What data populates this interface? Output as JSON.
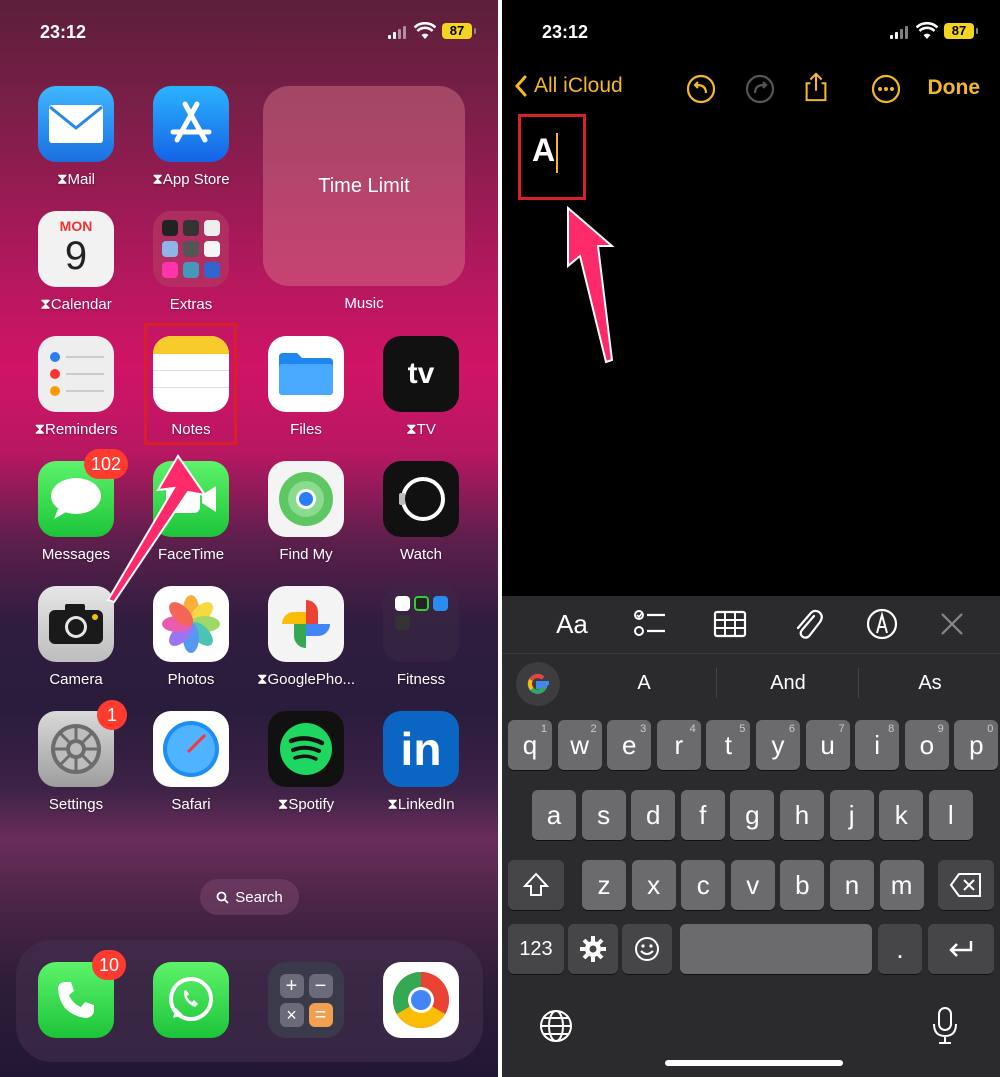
{
  "left_screen": {
    "status": {
      "time": "23:12",
      "battery": "87"
    },
    "apps": {
      "mail": "Mail",
      "app_store": "App Store",
      "time_limit_widget": "Time Limit",
      "music": "Music",
      "calendar_day": "MON",
      "calendar_date": "9",
      "calendar": "Calendar",
      "extras": "Extras",
      "reminders": "Reminders",
      "notes": "Notes",
      "files": "Files",
      "tv": "TV",
      "tv_icon_text": "tv",
      "messages": "Messages",
      "messages_badge": "102",
      "facetime": "FaceTime",
      "find_my": "Find My",
      "watch": "Watch",
      "camera": "Camera",
      "photos": "Photos",
      "google_photos": "GooglePho...",
      "fitness": "Fitness",
      "settings": "Settings",
      "settings_badge": "1",
      "safari": "Safari",
      "spotify": "Spotify",
      "linkedin": "LinkedIn",
      "linkedin_icon_text": "in"
    },
    "search_label": "Search",
    "dock": {
      "phone_badge": "10"
    }
  },
  "right_screen": {
    "status": {
      "time": "23:12",
      "battery": "87"
    },
    "nav": {
      "back_label": "All iCloud",
      "done_label": "Done"
    },
    "note_text": "A",
    "toolbar": {
      "format_label": "Aa"
    },
    "suggestions": [
      "A",
      "And",
      "As"
    ],
    "keys": {
      "row1": [
        {
          "k": "q",
          "n": "1"
        },
        {
          "k": "w",
          "n": "2"
        },
        {
          "k": "e",
          "n": "3"
        },
        {
          "k": "r",
          "n": "4"
        },
        {
          "k": "t",
          "n": "5"
        },
        {
          "k": "y",
          "n": "6"
        },
        {
          "k": "u",
          "n": "7"
        },
        {
          "k": "i",
          "n": "8"
        },
        {
          "k": "o",
          "n": "9"
        },
        {
          "k": "p",
          "n": "0"
        }
      ],
      "row2": [
        "a",
        "s",
        "d",
        "f",
        "g",
        "h",
        "j",
        "k",
        "l"
      ],
      "row3": [
        "z",
        "x",
        "c",
        "v",
        "b",
        "n",
        "m"
      ],
      "numbers": "123",
      "period": "."
    }
  },
  "colors": {
    "accent": "#f3b826",
    "highlight": "#d8202a",
    "arrow": "#ff2a6a"
  }
}
